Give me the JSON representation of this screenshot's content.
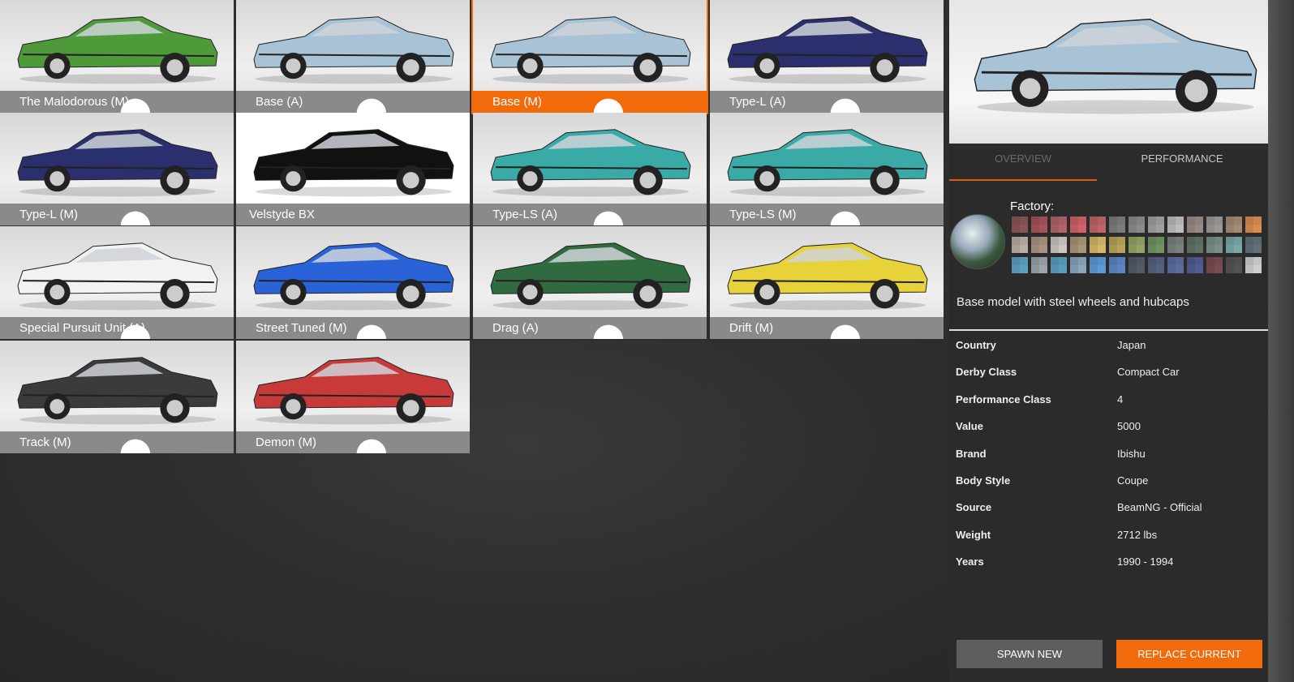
{
  "configs": [
    {
      "label": "The Malodorous (M)",
      "color": "#4e9a3a",
      "icon": "config-icon"
    },
    {
      "label": "Base (A)",
      "color": "#a9c3d6",
      "icon": "config-icon"
    },
    {
      "label": "Base (M)",
      "color": "#a9c3d6",
      "icon": "config-icon",
      "selected": true
    },
    {
      "label": "Type-L (A)",
      "color": "#2c2f6e",
      "icon": "config-icon"
    },
    {
      "label": "Type-L (M)",
      "color": "#2c2f6e",
      "icon": "config-icon"
    },
    {
      "label": "Velstyde BX",
      "color": "#111111",
      "white": true
    },
    {
      "label": "Type-LS (A)",
      "color": "#3aaaa6",
      "icon": "config-icon"
    },
    {
      "label": "Type-LS (M)",
      "color": "#3aaaa6",
      "icon": "config-icon"
    },
    {
      "label": "Special Pursuit Unit (A)",
      "color": "#f2f2f2",
      "icon": "config-icon"
    },
    {
      "label": "Street Tuned (M)",
      "color": "#2a63d8",
      "icon": "config-icon"
    },
    {
      "label": "Drag (A)",
      "color": "#2f6b3e",
      "icon": "config-icon"
    },
    {
      "label": "Drift (M)",
      "color": "#e8d23a",
      "icon": "config-icon"
    },
    {
      "label": "Track (M)",
      "color": "#3b3b3b",
      "icon": "config-icon"
    },
    {
      "label": "Demon (M)",
      "color": "#c83a3a",
      "icon": "config-icon"
    }
  ],
  "preview_color": "#a9c3d6",
  "tabs": {
    "overview": "OVERVIEW",
    "performance": "PERFORMANCE"
  },
  "factory_label": "Factory:",
  "swatch_colors": [
    "#8a5555",
    "#a8525a",
    "#b06468",
    "#cf6266",
    "#c06468",
    "#7c7c7c",
    "#8a8a8a",
    "#a0a0a0",
    "#bcbcbc",
    "#9a8a86",
    "#9c9894",
    "#a58a74",
    "#d88c50",
    "#b9aea4",
    "#aa9280",
    "#cbc6c0",
    "#a99475",
    "#d4b868",
    "#b8a458",
    "#94a464",
    "#6e9462",
    "#7a827c",
    "#607264",
    "#789088",
    "#7aa8a8",
    "#607078",
    "#5ea0c0",
    "#9aa4aa",
    "#5c9cc0",
    "#8ca4bc",
    "#5c9ad8",
    "#5a86c6",
    "#545a68",
    "#566080",
    "#5c6ca0",
    "#505c94",
    "#7c4a52",
    "#545454",
    "#cfcfcf"
  ],
  "description": "Base model with steel wheels and hubcaps",
  "info": [
    {
      "key": "Country",
      "value": "Japan"
    },
    {
      "key": "Derby Class",
      "value": "Compact Car"
    },
    {
      "key": "Performance Class",
      "value": "4"
    },
    {
      "key": "Value",
      "value": "5000"
    },
    {
      "key": "Brand",
      "value": "Ibishu"
    },
    {
      "key": "Body Style",
      "value": "Coupe"
    },
    {
      "key": "Source",
      "value": "BeamNG - Official"
    },
    {
      "key": "Weight",
      "value": "2712 lbs"
    },
    {
      "key": "Years",
      "value": "1990 - 1994"
    }
  ],
  "buttons": {
    "spawn": "SPAWN NEW",
    "replace": "REPLACE CURRENT"
  }
}
